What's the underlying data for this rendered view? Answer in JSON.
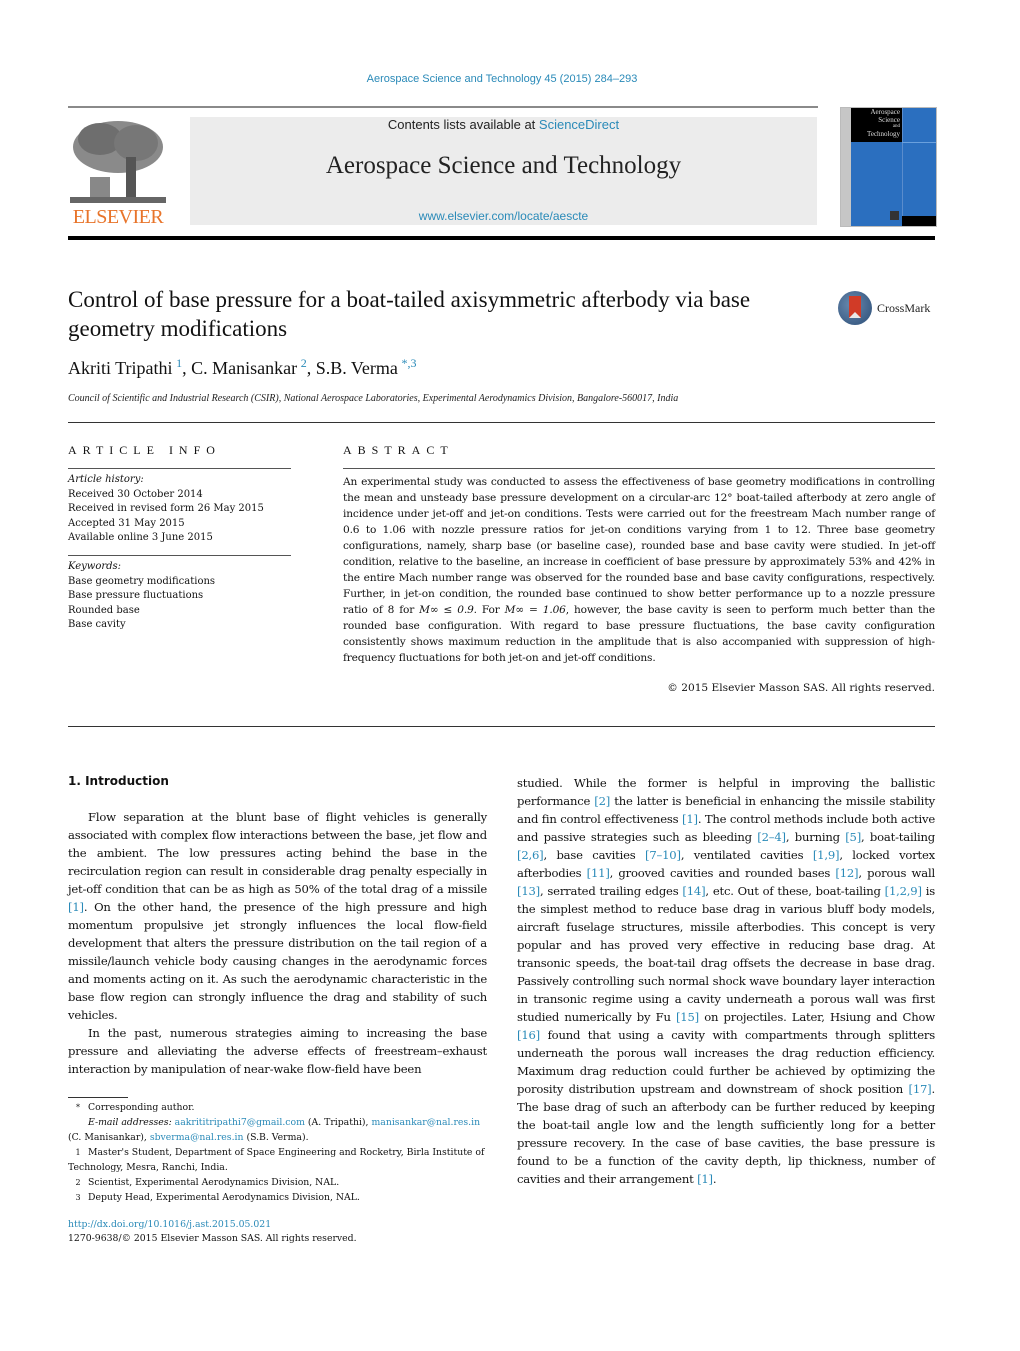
{
  "header": {
    "journal_ref": "Aerospace Science and Technology 45 (2015) 284–293",
    "contents_prefix": "Contents lists available at ",
    "contents_link": "ScienceDirect",
    "journal_title": "Aerospace Science and Technology",
    "journal_url": "www.elsevier.com/locate/aescte",
    "publisher_logo_text": "ELSEVIER",
    "cover_title_lines": [
      "Aerospace",
      "Science",
      "and",
      "Technology"
    ],
    "crossmark_label": "CrossMark"
  },
  "colors": {
    "link": "#2a8ab8",
    "elsevier_orange": "#e8742a",
    "masthead_bg": "#ececec",
    "cover_blue": "#2b6fbf"
  },
  "article": {
    "title": "Control of base pressure for a boat-tailed axisymmetric afterbody via base geometry modifications",
    "authors": [
      {
        "name": "Akriti Tripathi",
        "mark": "1"
      },
      {
        "name": "C. Manisankar",
        "mark": "2"
      },
      {
        "name": "S.B. Verma",
        "mark": "*,3"
      }
    ],
    "affiliation": "Council of Scientific and Industrial Research (CSIR), National Aerospace Laboratories, Experimental Aerodynamics Division, Bangalore-560017, India"
  },
  "article_info": {
    "heading": "ARTICLE INFO",
    "history_label": "Article history:",
    "history": [
      "Received 30 October 2014",
      "Received in revised form 26 May 2015",
      "Accepted 31 May 2015",
      "Available online 3 June 2015"
    ],
    "keywords_label": "Keywords:",
    "keywords": [
      "Base geometry modifications",
      "Base pressure fluctuations",
      "Rounded base",
      "Base cavity"
    ]
  },
  "abstract": {
    "heading": "ABSTRACT",
    "text_1": "An experimental study was conducted to assess the effectiveness of base geometry modifications in controlling the mean and unsteady base pressure development on a circular-arc 12° boat-tailed afterbody at zero angle of incidence under jet-off and jet-on conditions. Tests were carried out for the freestream Mach number range of 0.6 to 1.06 with nozzle pressure ratios for jet-on conditions varying from 1 to 12. Three base geometry configurations, namely, sharp base (or baseline case), rounded base and base cavity were studied. In jet-off condition, relative to the baseline, an increase in coefficient of base pressure by approximately 53% and 42% in the entire Mach number range was observed for the rounded base and base cavity configurations, respectively. Further, in jet-on condition, the rounded base continued to show better performance up to a nozzle pressure ratio of 8 for ",
    "math_1": "M∞ ≤ 0.9",
    "text_2": ". For ",
    "math_2": "M∞ = 1.06",
    "text_3": ", however, the base cavity is seen to perform much better than the rounded base configuration. With regard to base pressure fluctuations, the base cavity configuration consistently shows maximum reduction in the amplitude that is also accompanied with suppression of high-frequency fluctuations for both jet-on and jet-off conditions.",
    "copyright": "© 2015 Elsevier Masson SAS. All rights reserved."
  },
  "introduction": {
    "heading": "1. Introduction",
    "left_p1_a": "Flow separation at the blunt base of flight vehicles is generally associated with complex flow interactions between the base, jet flow and the ambient. The low pressures acting behind the base in the recirculation region can result in considerable drag penalty especially in jet-off condition that can be as high as 50% of the total drag of a missile ",
    "ref_1": "[1]",
    "left_p1_b": ". On the other hand, the presence of the high pressure and high momentum propulsive jet strongly influences the local flow-field development that alters the pressure distribution on the tail region of a missile/launch vehicle body causing changes in the aerodynamic forces and moments acting on it. As such the aerodynamic characteristic in the base flow region can strongly influence the drag and stability of such vehicles.",
    "left_p2": "In the past, numerous strategies aiming to increasing the base pressure and alleviating the adverse effects of freestream–exhaust interaction by manipulation of near-wake flow-field have been",
    "right": [
      {
        "t": "studied. While the former is helpful in improving the ballistic performance "
      },
      {
        "r": "[2]"
      },
      {
        "t": " the latter is beneficial in enhancing the missile stability and fin control effectiveness "
      },
      {
        "r": "[1]"
      },
      {
        "t": ". The control methods include both active and passive strategies such as bleeding "
      },
      {
        "r": "[2–4]"
      },
      {
        "t": ", burning "
      },
      {
        "r": "[5]"
      },
      {
        "t": ", boat-tailing "
      },
      {
        "r": "[2,6]"
      },
      {
        "t": ", base cavities "
      },
      {
        "r": "[7–10]"
      },
      {
        "t": ", ventilated cavities "
      },
      {
        "r": "[1,9]"
      },
      {
        "t": ", locked vortex afterbodies "
      },
      {
        "r": "[11]"
      },
      {
        "t": ", grooved cavities and rounded bases "
      },
      {
        "r": "[12]"
      },
      {
        "t": ", porous wall "
      },
      {
        "r": "[13]"
      },
      {
        "t": ", serrated trailing edges "
      },
      {
        "r": "[14]"
      },
      {
        "t": ", etc. Out of these, boat-tailing "
      },
      {
        "r": "[1,2,9]"
      },
      {
        "t": " is the simplest method to reduce base drag in various bluff body models, aircraft fuselage structures, missile afterbodies. This concept is very popular and has proved very effective in reducing base drag. At transonic speeds, the boat-tail drag offsets the decrease in base drag. Passively controlling such normal shock wave boundary layer interaction in transonic regime using a cavity underneath a porous wall was first studied numerically by Fu "
      },
      {
        "r": "[15]"
      },
      {
        "t": " on projectiles. Later, Hsiung and Chow "
      },
      {
        "r": "[16]"
      },
      {
        "t": " found that using a cavity with compartments through splitters underneath the porous wall increases the drag reduction efficiency. Maximum drag reduction could further be achieved by optimizing the porosity distribution upstream and downstream of shock position "
      },
      {
        "r": "[17]"
      },
      {
        "t": ". The base drag of such an afterbody can be further reduced by keeping the boat-tail angle low and the length sufficiently long for a better pressure recovery. In the case of base cavities, the base pressure is found to be a function of the cavity depth, lip thickness, number of cavities and their arrangement "
      },
      {
        "r": "[1]"
      },
      {
        "t": "."
      }
    ]
  },
  "footnotes": {
    "corresponding_mark": "*",
    "corresponding": "Corresponding author.",
    "email_label": "E-mail addresses:",
    "email_1": "aakrititripathi7@gmail.com",
    "email_1_owner": " (A. Tripathi), ",
    "email_2": "manisankar@nal.res.in",
    "email_2_owner": "(C. Manisankar), ",
    "email_3": "sbverma@nal.res.in",
    "email_3_owner": " (S.B. Verma).",
    "notes": [
      {
        "mark": "1",
        "text": "Master's Student, Department of Space Engineering and Rocketry, Birla Institute of Technology, Mesra, Ranchi, India."
      },
      {
        "mark": "2",
        "text": "Scientist, Experimental Aerodynamics Division, NAL."
      },
      {
        "mark": "3",
        "text": "Deputy Head, Experimental Aerodynamics Division, NAL."
      }
    ],
    "doi": "http://dx.doi.org/10.1016/j.ast.2015.05.021",
    "issn": "1270-9638/© 2015 Elsevier Masson SAS. All rights reserved."
  }
}
